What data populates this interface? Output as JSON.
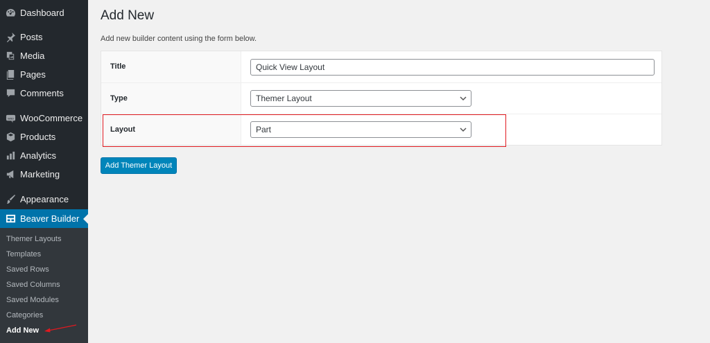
{
  "sidebar": {
    "menu": [
      {
        "label": "Dashboard",
        "icon": "dashboard-icon"
      },
      {
        "label": "Posts",
        "icon": "pin-icon"
      },
      {
        "label": "Media",
        "icon": "media-icon"
      },
      {
        "label": "Pages",
        "icon": "pages-icon"
      },
      {
        "label": "Comments",
        "icon": "comment-icon"
      },
      {
        "label": "WooCommerce",
        "icon": "woocommerce-icon"
      },
      {
        "label": "Products",
        "icon": "box-icon"
      },
      {
        "label": "Analytics",
        "icon": "bar-chart-icon"
      },
      {
        "label": "Marketing",
        "icon": "megaphone-icon"
      },
      {
        "label": "Appearance",
        "icon": "brush-icon"
      },
      {
        "label": "Beaver Builder",
        "icon": "layout-icon"
      }
    ],
    "submenu": [
      {
        "label": "Themer Layouts"
      },
      {
        "label": "Templates"
      },
      {
        "label": "Saved Rows"
      },
      {
        "label": "Saved Columns"
      },
      {
        "label": "Saved Modules"
      },
      {
        "label": "Categories"
      },
      {
        "label": "Add New"
      }
    ],
    "active_menu": "Beaver Builder",
    "current_submenu": "Add New"
  },
  "main": {
    "title": "Add New",
    "description": "Add new builder content using the form below.",
    "form": {
      "title_label": "Title",
      "title_value": "Quick View Layout",
      "type_label": "Type",
      "type_value": "Themer Layout",
      "layout_label": "Layout",
      "layout_value": "Part"
    },
    "submit_label": "Add Themer Layout"
  },
  "colors": {
    "sidebar_bg": "#23282d",
    "submenu_bg": "#32373c",
    "accent": "#0073aa",
    "button": "#0085ba",
    "highlight": "#e0191f"
  }
}
